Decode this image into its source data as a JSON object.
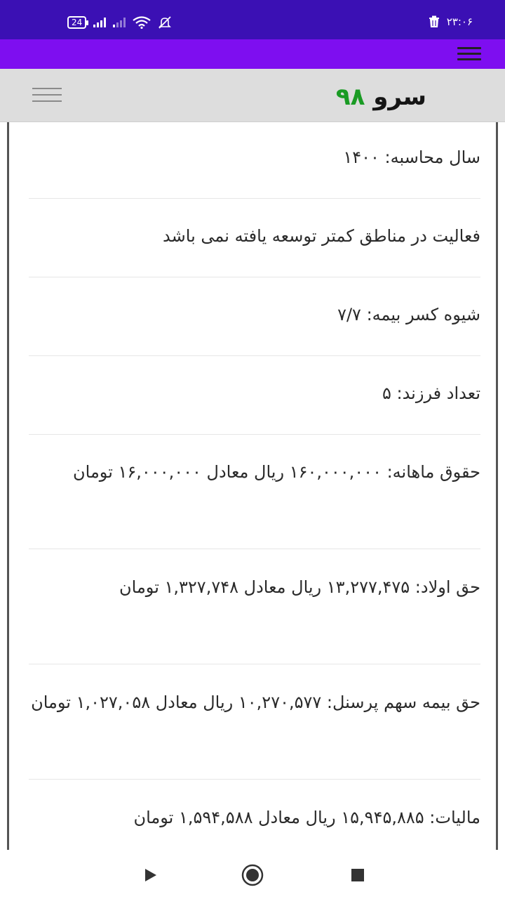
{
  "status_bar": {
    "battery": "24",
    "time": "۲۳:۰۶"
  },
  "header": {
    "brand_name": "سرو",
    "brand_number": "۹۸"
  },
  "items": [
    "سال محاسبه: ۱۴۰۰",
    "فعالیت در مناطق کمتر توسعه یافته نمی باشد",
    "شیوه کسر بیمه: ۷/۷",
    "تعداد فرزند: ۵",
    "حقوق ماهانه: ۱۶۰,۰۰۰,۰۰۰ ریال معادل ۱۶,۰۰۰,۰۰۰ تومان",
    "حق اولاد: ۱۳,۲۷۷,۴۷۵ ریال معادل ۱,۳۲۷,۷۴۸ تومان",
    "حق بیمه سهم پرسنل: ۱۰,۲۷۰,۵۷۷ ریال معادل ۱,۰۲۷,۰۵۸ تومان",
    "مالیات: ۱۵,۹۴۵,۸۸۵ ریال معادل ۱,۵۹۴,۵۸۸ تومان"
  ],
  "colors": {
    "status_bar": "#3b10b4",
    "app_bar": "#7e0ef0",
    "header_bg": "#dddddd",
    "brand_accent": "#1a9b24"
  },
  "icons": {
    "nav_back": "triangle-play-icon",
    "nav_home": "circle-home-icon",
    "nav_recents": "square-recents-icon"
  }
}
